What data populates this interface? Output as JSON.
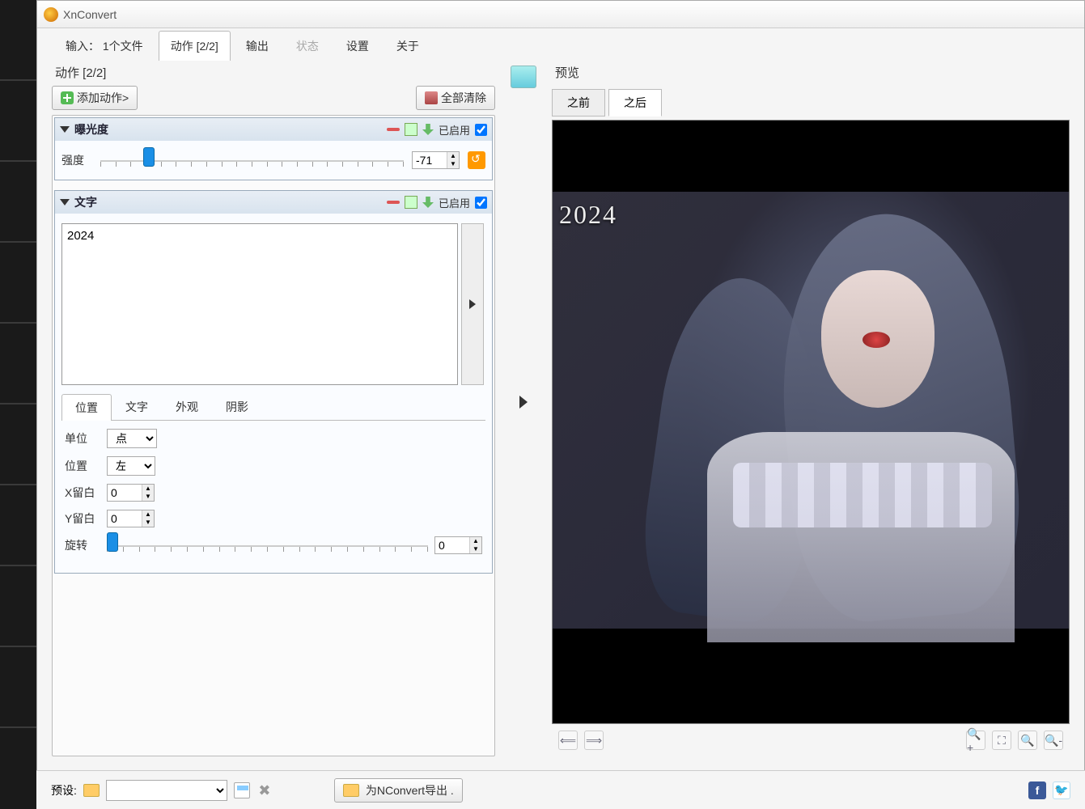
{
  "app": {
    "title": "XnConvert"
  },
  "main_tabs": {
    "input": "输入： 1个文件",
    "actions": "动作 [2/2]",
    "output": "输出",
    "status": "状态",
    "settings": "设置",
    "about": "关于"
  },
  "actions_area": {
    "title": "动作 [2/2]",
    "add_button": "添加动作>",
    "clear_button": "全部清除",
    "enabled_label": "已启用"
  },
  "action_exposure": {
    "title": "曝光度",
    "intensity_label": "强度",
    "intensity_value": "-71"
  },
  "action_text": {
    "title": "文字",
    "text_value": "2024",
    "sub_tabs": {
      "position": "位置",
      "text": "文字",
      "appearance": "外观",
      "shadow": "阴影"
    },
    "unit_label": "单位",
    "unit_value": "点",
    "pos_label": "位置",
    "pos_value": "左上",
    "x_margin_label": "X留白",
    "x_margin_value": "0",
    "y_margin_label": "Y留白",
    "y_margin_value": "0",
    "rotate_label": "旋转",
    "rotate_value": "0"
  },
  "preview": {
    "title": "预览",
    "before": "之前",
    "after": "之后",
    "watermark": "2024"
  },
  "footer": {
    "preset_label": "预设:",
    "export_button": "为NConvert导出 ."
  }
}
